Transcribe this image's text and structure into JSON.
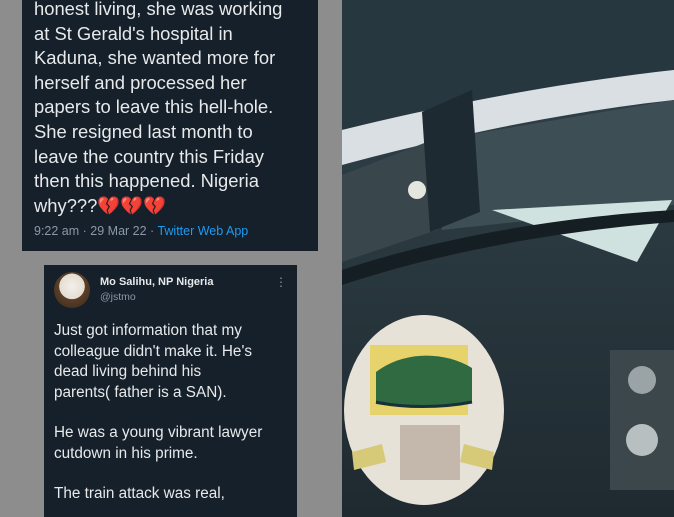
{
  "tweet1": {
    "text": "honest living, she was working\nat St Gerald's hospital in\nKaduna, she wanted more for\nherself and processed her\npapers to leave this hell-hole.\nShe resigned last month to\nleave the country this Friday\nthen this happened. Nigeria\nwhy???",
    "emoji": "💔💔💔",
    "time": "9:22 am",
    "date": "29 Mar 22",
    "source": "Twitter Web App"
  },
  "tweet2": {
    "name": "Mo Salihu, NP Nigeria",
    "handle": "@jstmo",
    "more": "⋮",
    "paragraphs": [
      "Just got information that my\ncolleague didn't make it. He's\ndead living behind his\nparents( father is a SAN).",
      "He was a young vibrant lawyer\ncutdown in his prime.",
      "The train attack was real,"
    ]
  },
  "photo": {
    "subject": "train locomotive front with emblem"
  }
}
